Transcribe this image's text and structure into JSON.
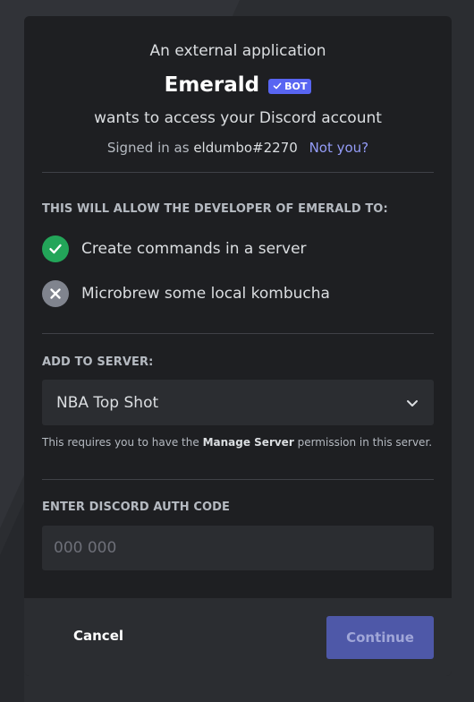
{
  "header": {
    "intro": "An external application",
    "bot_name": "Emerald",
    "bot_badge": "BOT",
    "wants": "wants to access your Discord account",
    "signed_in_prefix": "Signed in as",
    "username": "eldumbo#2270",
    "not_you": "Not you?"
  },
  "permissions": {
    "label": "THIS WILL ALLOW THE DEVELOPER OF EMERALD TO:",
    "items": [
      {
        "label": "Create commands in a server",
        "status": "allowed",
        "icon": "checkmark-icon"
      },
      {
        "label": "Microbrew some local kombucha",
        "status": "denied",
        "icon": "x-icon"
      }
    ]
  },
  "server": {
    "label": "ADD TO SERVER:",
    "selected": "NBA Top Shot",
    "hint_prefix": "This requires you to have the",
    "hint_bold": "Manage Server",
    "hint_suffix": "permission in this server."
  },
  "auth": {
    "label": "ENTER DISCORD AUTH CODE",
    "placeholder": "000 000",
    "value": ""
  },
  "footer": {
    "cancel_label": "Cancel",
    "continue_label": "Continue"
  },
  "colors": {
    "accent": "#5865f2",
    "success": "#23a559",
    "link": "#949cf7",
    "modal_bg": "#1e1f22",
    "page_bg": "#2b2d31"
  }
}
